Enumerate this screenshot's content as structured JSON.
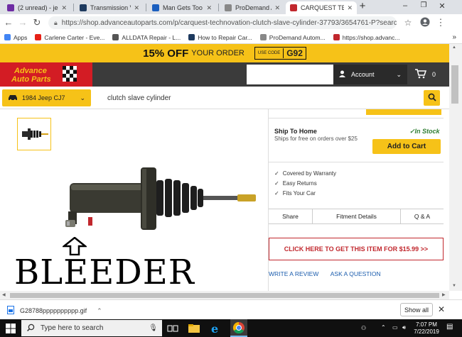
{
  "browser": {
    "tabs": [
      {
        "title": "(2 unread) - jeep",
        "color": "#6e2ca3"
      },
      {
        "title": "Transmission Very",
        "color": "#1e3a5f"
      },
      {
        "title": "Man Gets Too Clo",
        "color": "#1b5fbf"
      },
      {
        "title": "ProDemand Auto",
        "color": "#888888"
      },
      {
        "title": "CARQUEST TECH",
        "color": "#c1272d"
      }
    ],
    "url": "https://shop.advanceautoparts.com/p/carquest-technovation-clutch-slave-cylinder-37793/3654761-P?searchTerm=clutch...",
    "bookmarks": [
      {
        "label": "Apps",
        "color": "#4285f4"
      },
      {
        "label": "Carlene Carter - Eve...",
        "color": "#e62117"
      },
      {
        "label": "ALLDATA Repair - L...",
        "color": "#555555"
      },
      {
        "label": "How to Repair Car...",
        "color": "#1e3a5f"
      },
      {
        "label": "ProDemand Autom...",
        "color": "#888888"
      },
      {
        "label": "https://shop.advanc...",
        "color": "#c1272d"
      }
    ]
  },
  "promo": {
    "big": "15% OFF",
    "small": "YOUR ORDER",
    "code_label": "USE CODE",
    "code": "G92"
  },
  "header": {
    "account": "Account",
    "cart_count": "0"
  },
  "vehicle": {
    "label": "1984 Jeep CJ7"
  },
  "search": {
    "query": "clutch slave cylinder"
  },
  "product": {
    "ship_title": "Ship To Home",
    "in_stock": "✓In Stock",
    "ship_sub": "Ships for free on orders over $25",
    "add_to_cart": "Add to Cart",
    "perks": [
      "Covered by Warranty",
      "Easy Returns",
      "Fits Your Car"
    ],
    "tabs": [
      "Share",
      "Fitment Details",
      "Q & A"
    ],
    "promo_link": "CLICK HERE TO GET THIS ITEM FOR $15.99  >>",
    "write_review": "WRITE A REVIEW",
    "ask_question": "ASK A QUESTION"
  },
  "annotation": {
    "text": "BLEEDER"
  },
  "downloads": {
    "filename": "G28788pppppppppp.gif",
    "show_all": "Show all"
  },
  "taskbar": {
    "search_placeholder": "Type here to search",
    "time": "7:07 PM",
    "date": "7/22/2019"
  },
  "colors": {
    "brand_yellow": "#f6c218",
    "brand_red": "#d31c24",
    "header_dark": "#3b3b3b"
  }
}
